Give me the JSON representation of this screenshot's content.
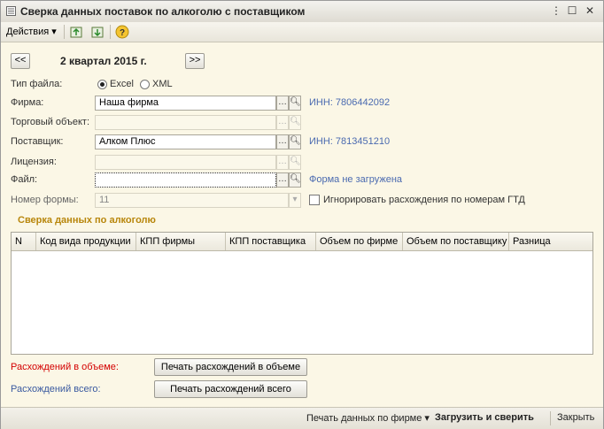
{
  "window": {
    "title": "Сверка данных поставок по алкоголю с поставщиком"
  },
  "toolbar": {
    "actions_label": "Действия",
    "help_icon": "help-icon"
  },
  "period": {
    "prev_label": "<<",
    "next_label": ">>",
    "current": "2 квартал 2015 г."
  },
  "form": {
    "file_type_label": "Тип файла:",
    "file_type_options": [
      "Excel",
      "XML"
    ],
    "file_type_selected": "Excel",
    "firm_label": "Фирма:",
    "firm_value": "Наша фирма",
    "firm_inn": "ИНН: 7806442092",
    "trade_object_label": "Торговый объект:",
    "trade_object_value": "",
    "supplier_label": "Поставщик:",
    "supplier_value": "Алком Плюс",
    "supplier_inn": "ИНН: 7813451210",
    "license_label": "Лицензия:",
    "license_value": "",
    "file_label": "Файл:",
    "file_value": "",
    "file_status": "Форма не загружена",
    "form_number_label": "Номер формы:",
    "form_number_value": "11",
    "ignore_gtd_label": "Игнорировать расхождения по номерам ГТД",
    "ignore_gtd_checked": false
  },
  "section_title": "Сверка данных по алкоголю",
  "table": {
    "columns": [
      "N",
      "Код вида продукции",
      "КПП фирмы",
      "КПП поставщика",
      "Объем по фирме",
      "Объем по поставщику",
      "Разница"
    ],
    "rows": []
  },
  "discrepancies": {
    "volume_label": "Расхождений в объеме:",
    "volume_button": "Печать расхождений в объеме",
    "total_label": "Расхождений всего:",
    "total_button": "Печать расхождений всего"
  },
  "footer": {
    "print_firm": "Печать данных по фирме",
    "load_compare": "Загрузить и сверить",
    "close": "Закрыть"
  },
  "colors": {
    "section": "#b8860b",
    "link": "#4a6ab0",
    "error_label": "#d40000"
  }
}
